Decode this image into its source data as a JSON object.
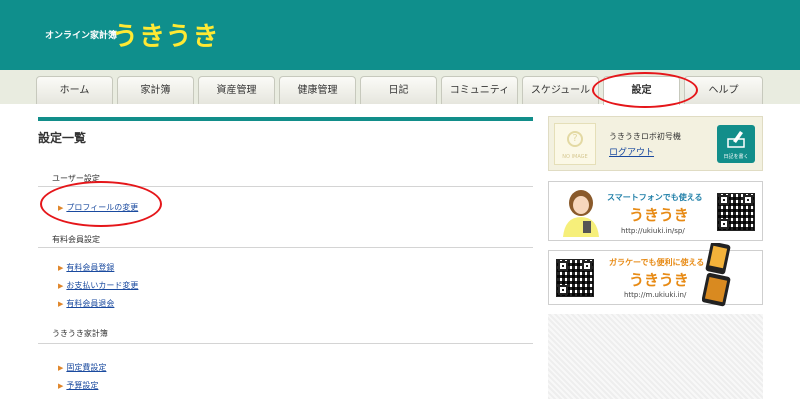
{
  "header": {
    "brand_small": "オンライン家計簿",
    "brand_big": "うきうき"
  },
  "nav": {
    "tabs": [
      "ホーム",
      "家計簿",
      "資産管理",
      "健康管理",
      "日記",
      "コミュニティ",
      "スケジュール",
      "設定",
      "ヘルプ"
    ],
    "active": "設定"
  },
  "main": {
    "title": "設定一覧",
    "sections": [
      {
        "heading": "ユーザー設定",
        "links": [
          "プロフィールの変更"
        ]
      },
      {
        "heading": "有料会員設定",
        "links": [
          "有料会員登録",
          "お支払いカード変更",
          "有料会員退会"
        ]
      },
      {
        "heading": "うきうき家計簿",
        "links": [
          "固定費設定",
          "予算設定"
        ]
      }
    ]
  },
  "sidebar": {
    "noimage_label": "NO IMAGE",
    "user_name": "うきうきロボ初号機",
    "logout": "ログアウト",
    "diary_button": "日記を書く",
    "smartphone_banner": {
      "line1": "スマートフォンでも使える",
      "line2": "うきうき",
      "url": "http://ukiuki.in/sp/"
    },
    "mobile_banner": {
      "line1": "ガラケーでも便利に使える",
      "line2": "うきうき",
      "url": "http://m.ukiuki.in/"
    }
  },
  "colors": {
    "header": "#0f8f8c",
    "brand": "#ffe933",
    "accent_orange": "#e78a14",
    "highlight_red": "#e5161a",
    "link": "#1a4a9f"
  }
}
